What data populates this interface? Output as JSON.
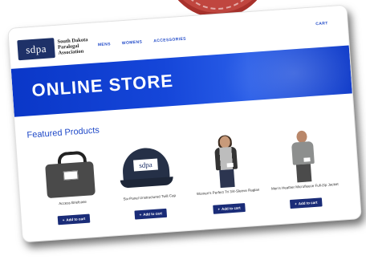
{
  "site": {
    "logo_abbr": "sdpa",
    "logo_name": "South Dakota Paralegal Association"
  },
  "nav": {
    "items": [
      "MENS",
      "WOMENS",
      "ACCESSORIES"
    ],
    "cart": "CART"
  },
  "hero": {
    "title": "ONLINE STORE"
  },
  "featured": {
    "heading": "Featured Products"
  },
  "products": [
    {
      "name": "Access Briefcase",
      "button": "Add to cart",
      "icon": "plus-icon"
    },
    {
      "name": "Six-Panel Unstructured Twill Cap",
      "button": "Add to cart",
      "icon": "plus-icon"
    },
    {
      "name": "Women's Perfect Tri 3/4-Sleeve Raglan",
      "button": "Add to cart",
      "icon": "plus-icon"
    },
    {
      "name": "Men's Heather Microfleece Full-Zip Jacket",
      "button": "Add to cart",
      "icon": "plus-icon"
    }
  ],
  "colors": {
    "brand_navy": "#1e3168",
    "nav_blue": "#1f49c8",
    "hero_blue": "#1546d9",
    "button_navy": "#1a2c78",
    "seal_red": "#c0463f"
  }
}
